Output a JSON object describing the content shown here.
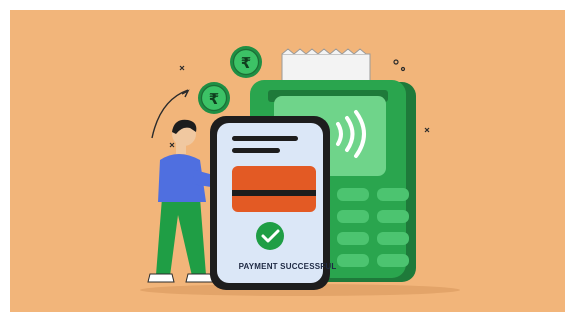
{
  "illustration": {
    "status_text": "PAYMENT SUCCESSFUL",
    "currency_symbol": "₹",
    "colors": {
      "background": "#f2b57a",
      "terminal_green": "#2aa54e",
      "terminal_dark": "#1e7a3a",
      "screen_green": "#6fd48a",
      "phone_screen": "#dbe7f7",
      "card_orange": "#e35a24",
      "shirt_blue": "#4f6fe0",
      "pants_green": "#1f9e45"
    },
    "icons": [
      "rupee-coin-icon",
      "contactless-icon",
      "checkmark-icon"
    ]
  }
}
